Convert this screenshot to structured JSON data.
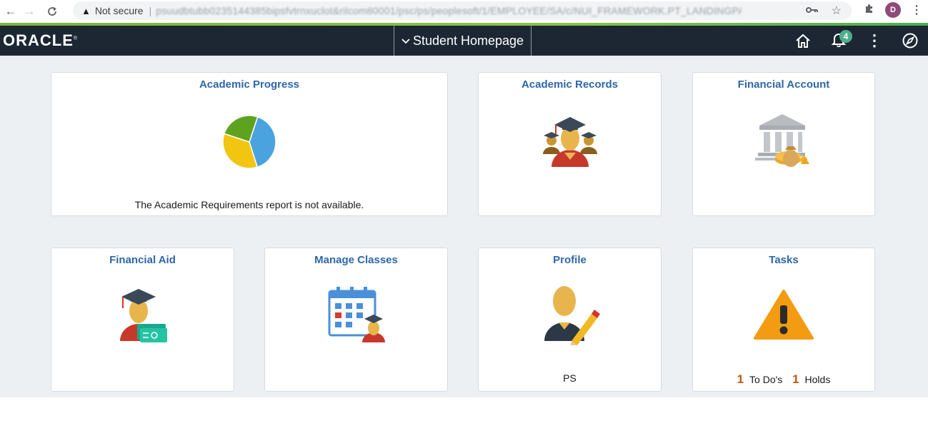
{
  "browser": {
    "back_icon": "←",
    "forward_icon": "→",
    "reload_icon": "C",
    "security_label": "Not secure",
    "url_blurred": "psuudbtubb0235144385bipsfvtrnxuclot&rilcom80001/psc/ps/peoplesoft/1/EMPLOYEE/SA/c/NUI_FRAMEWORK.PT_LANDINGPAGE.GBL?",
    "profile_initial": "D"
  },
  "header": {
    "logo": "ORACLE",
    "logo_mark": "®",
    "page_title": "Student Homepage",
    "notification_count": "4"
  },
  "tiles": {
    "academic_progress": {
      "title": "Academic Progress",
      "message": "The Academic Requirements report is not available."
    },
    "academic_records": {
      "title": "Academic Records"
    },
    "financial_account": {
      "title": "Financial Account"
    },
    "financial_aid": {
      "title": "Financial Aid"
    },
    "manage_classes": {
      "title": "Manage Classes"
    },
    "profile": {
      "title": "Profile",
      "name": "PS"
    },
    "tasks": {
      "title": "Tasks",
      "todo_count": "1",
      "todo_label": "To Do's",
      "holds_count": "1",
      "holds_label": "Holds"
    }
  },
  "colors": {
    "header_bg": "#1c2733",
    "tile_title": "#2e67a8",
    "page_bg": "#edf0f3",
    "badge": "#4caf8a",
    "count_orange": "#b85a18"
  },
  "chart_data": {
    "type": "pie",
    "title": "",
    "slices": [
      {
        "color": "#4aa3df",
        "value": 40
      },
      {
        "color": "#f2c511",
        "value": 35
      },
      {
        "color": "#5ea320",
        "value": 25
      }
    ]
  }
}
